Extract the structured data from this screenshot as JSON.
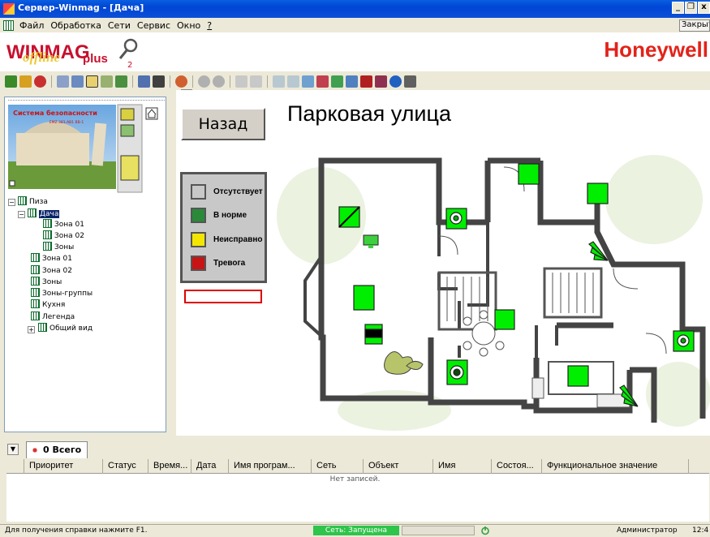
{
  "window": {
    "title": "Сервер-Winmag - [Дача]"
  },
  "menu": [
    "Файл",
    "Обработка",
    "Сети",
    "Сервис",
    "Окно",
    "?"
  ],
  "close_label": "Закрыть",
  "logo": {
    "text": "WINMAG",
    "overlay": "offline",
    "suffix": "plus",
    "badge": "2",
    "brand": "Honeywell"
  },
  "thumbnail": {
    "title": "Система безопасности",
    "subtitle": "EMZ 381-AB1 ВВ-1"
  },
  "tree": [
    {
      "label": "Пиза",
      "level": 0
    },
    {
      "label": "Дача",
      "level": 1,
      "selected": true
    },
    {
      "label": "Зона 01",
      "level": 2
    },
    {
      "label": "Зона 02",
      "level": 2
    },
    {
      "label": "Зоны",
      "level": 2
    },
    {
      "label": "Зона 01",
      "level": 1
    },
    {
      "label": "Зона 02",
      "level": 1
    },
    {
      "label": "Зоны",
      "level": 1
    },
    {
      "label": "Зоны-группы",
      "level": 1
    },
    {
      "label": "Кухня",
      "level": 1
    },
    {
      "label": "Легенда",
      "level": 1
    },
    {
      "label": "Общий вид",
      "level": 1
    }
  ],
  "scene": {
    "back_label": "Назад",
    "title": "Парковая улица"
  },
  "legend": [
    {
      "label": "Отсутствует",
      "color": "#c8c8c8"
    },
    {
      "label": "В норме",
      "color": "#2a8a3a"
    },
    {
      "label": "Неисправно",
      "color": "#f4e600"
    },
    {
      "label": "Тревога",
      "color": "#c81414"
    }
  ],
  "events": {
    "tab_label": "0 Всего",
    "columns": [
      "Приоритет",
      "Статус",
      "Время...",
      "Дата",
      "Имя програм...",
      "Сеть",
      "Объект",
      "Имя",
      "Состоя...",
      "Функциональное значение"
    ],
    "empty_text": "Нет записей."
  },
  "status": {
    "help": "Для получения справки нажмите F1.",
    "network": "Сеть: Запущена",
    "user": "Администратор",
    "time": "12:4"
  },
  "colors": {
    "sensor_green": "#00ee00",
    "alarm_red": "#e2231a",
    "xp_blue": "#0046d5"
  }
}
